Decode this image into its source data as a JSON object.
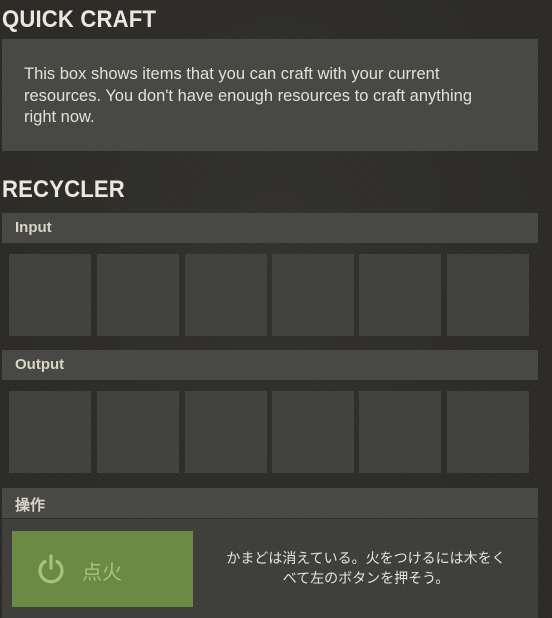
{
  "quick_craft": {
    "title": "QUICK CRAFT",
    "message": "This box shows items that you can craft with your current resources. You don't have enough resources to craft anything right now."
  },
  "recycler": {
    "title": "RECYCLER",
    "input_label": "Input",
    "output_label": "Output",
    "input_slot_count": 6,
    "output_slot_count": 6
  },
  "operation": {
    "label": "操作",
    "ignite_button": {
      "label": "点火",
      "icon": "power-icon",
      "color": "#6b8a44"
    },
    "status_line1": "かまどは消えている。火をつけるには木をく",
    "status_line2": "べて左のボタンを押そう。"
  },
  "colors": {
    "background": "#2c2b27",
    "panel": "#484845",
    "slot": "#424240",
    "button_green": "#6b8a44",
    "button_text": "#a9c27b"
  }
}
